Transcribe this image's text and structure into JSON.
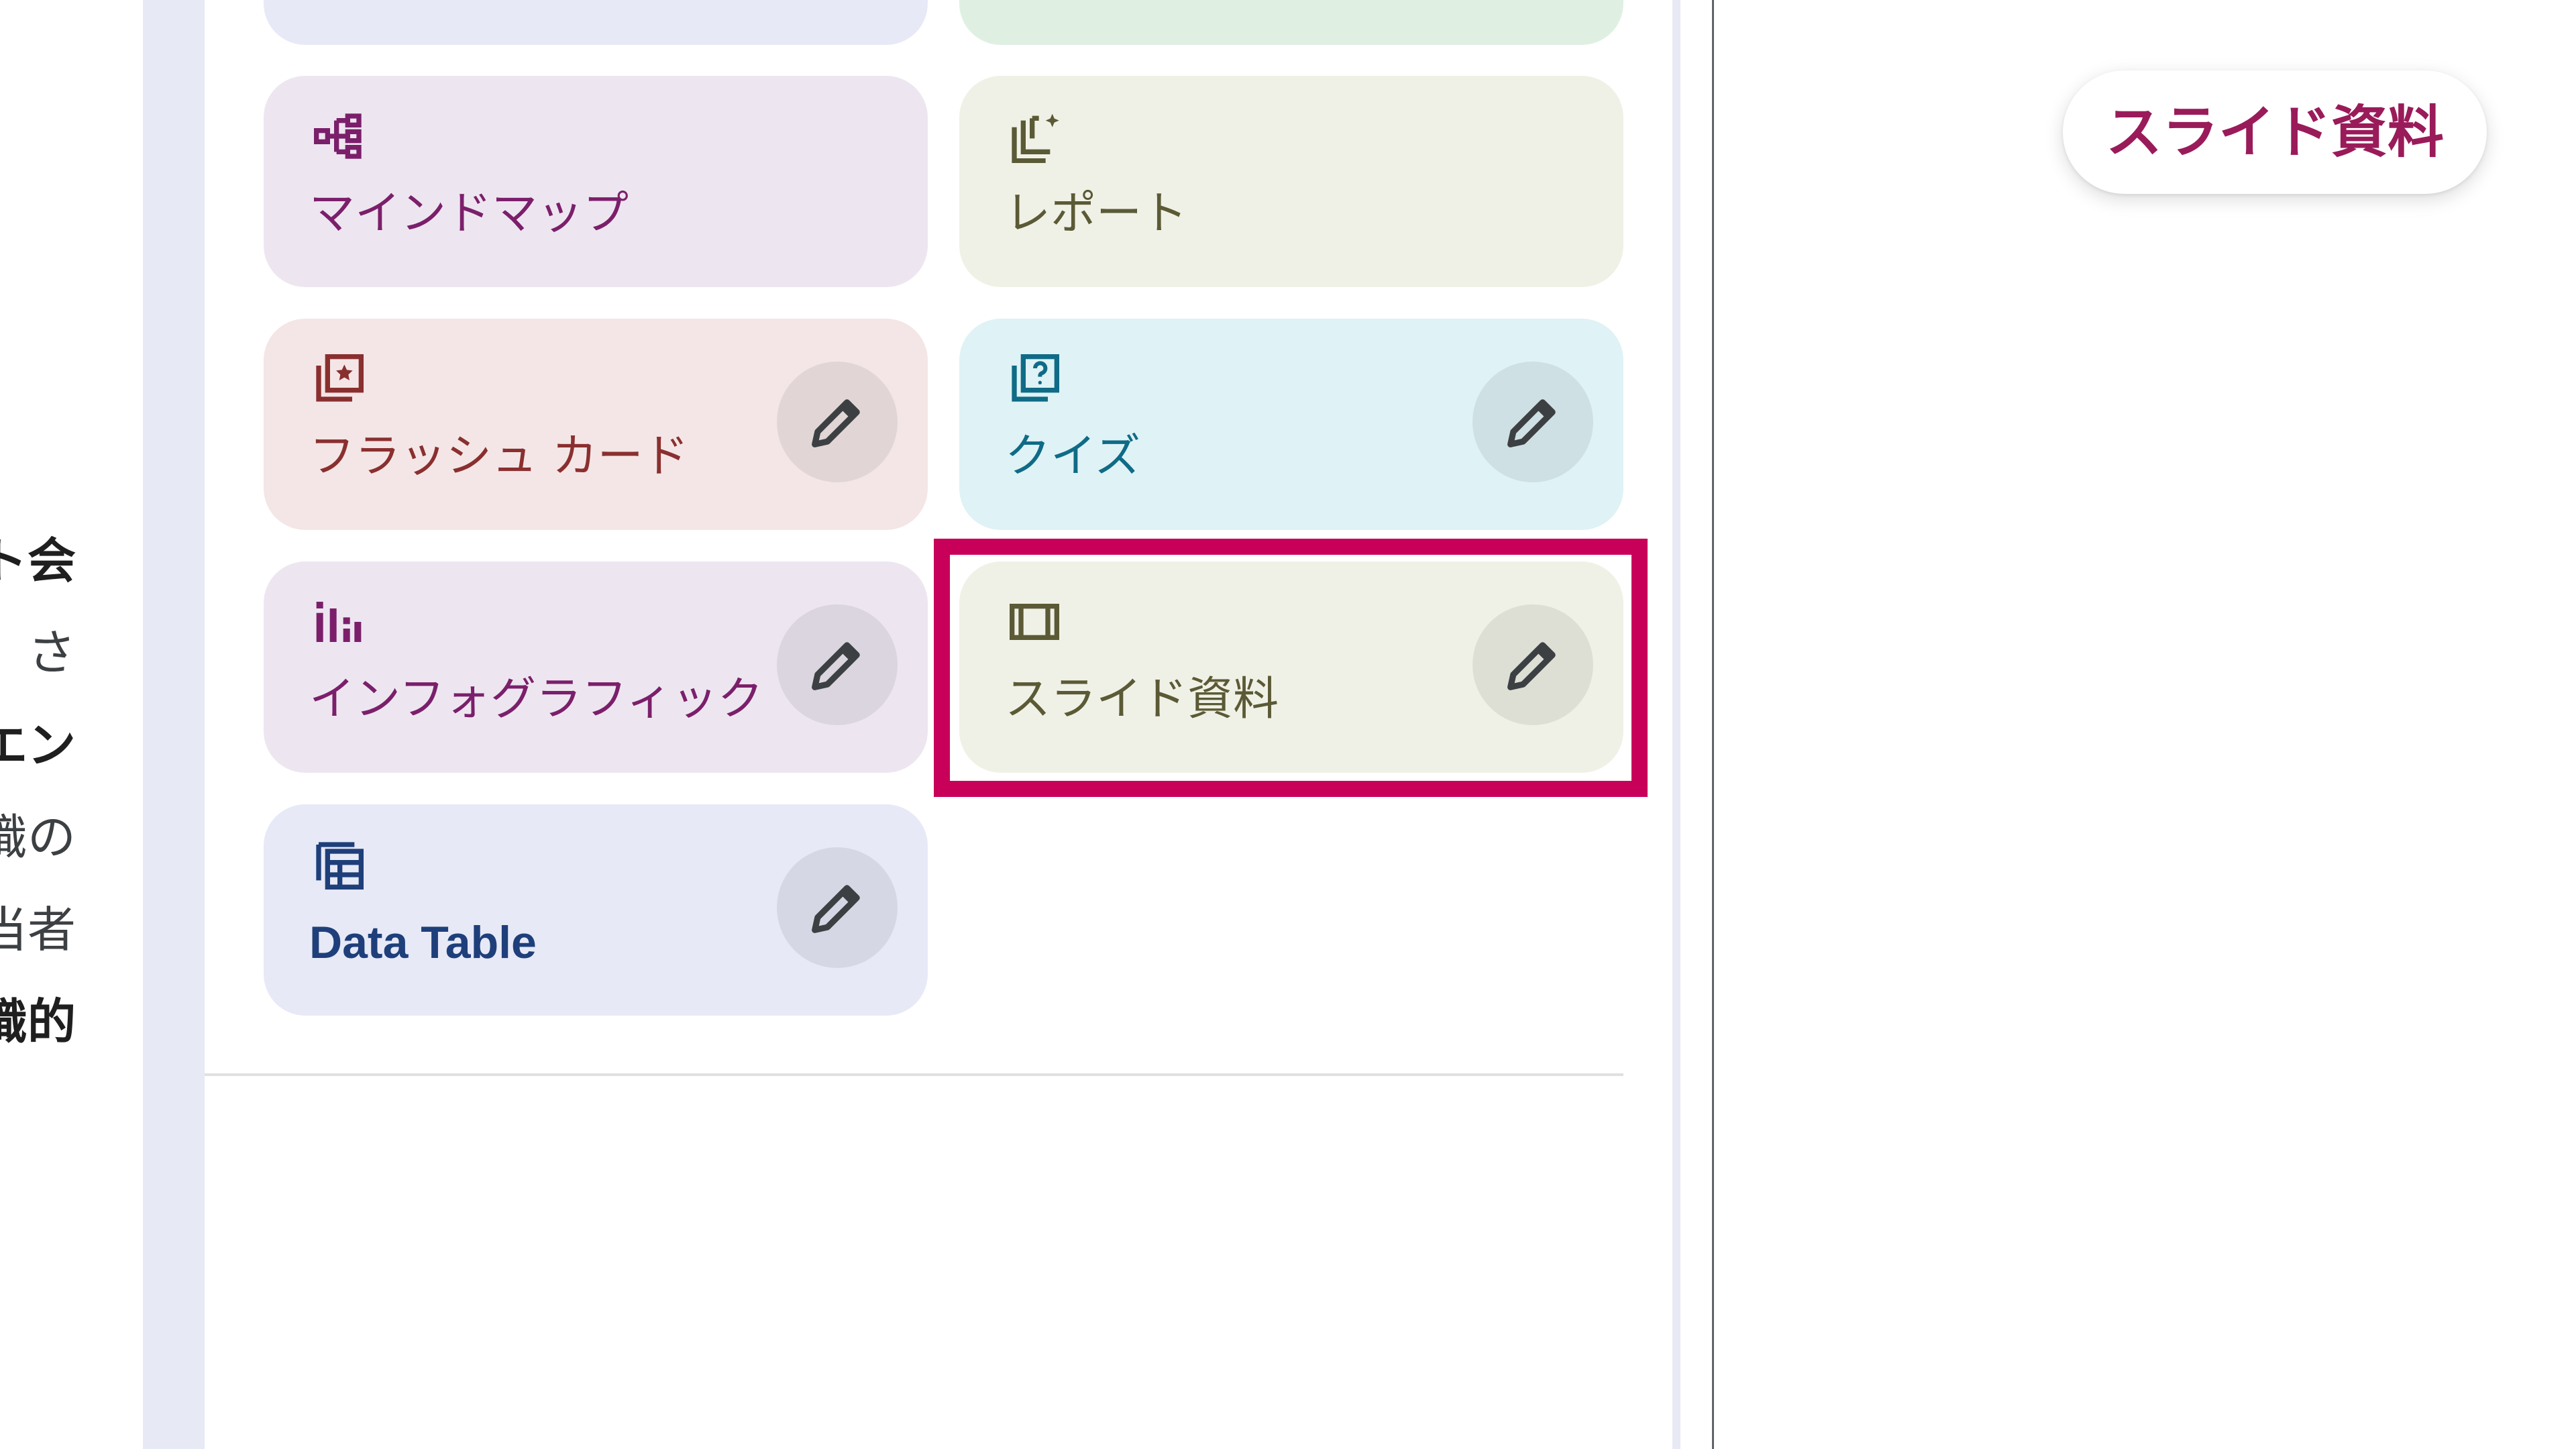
{
  "background_text": {
    "lines": [
      "ト会",
      "さ",
      "エン",
      "識の",
      "当者",
      "識的"
    ]
  },
  "studio": {
    "cards": [
      {
        "id": "mindmap",
        "label": "マインドマップ",
        "icon": "mindmap-icon",
        "editable": false,
        "bg": "#ede6f0",
        "fg": "#7b1f6b"
      },
      {
        "id": "report",
        "label": "レポート",
        "icon": "report-icon",
        "editable": false,
        "bg": "#f0f1e6",
        "fg": "#5b5a36"
      },
      {
        "id": "flashcards",
        "label": "フラッシュ カード",
        "icon": "flashcard-icon",
        "editable": true,
        "bg": "#f4e6e6",
        "fg": "#8a2f2f"
      },
      {
        "id": "quiz",
        "label": "クイズ",
        "icon": "quiz-icon",
        "editable": true,
        "bg": "#dff2f5",
        "fg": "#0f6b86"
      },
      {
        "id": "infographic",
        "label": "インフォグラフィック",
        "icon": "infographic-icon",
        "editable": true,
        "bg": "#ede6f0",
        "fg": "#7b1f6b"
      },
      {
        "id": "slides",
        "label": "スライド資料",
        "icon": "slides-icon",
        "editable": true,
        "bg": "#f0f1e6",
        "fg": "#5b5a36"
      },
      {
        "id": "datatable",
        "label": "Data Table",
        "icon": "table-icon",
        "editable": true,
        "bg": "#e7e9f7",
        "fg": "#1e3f7a"
      }
    ],
    "highlight_color": "#c8005a"
  },
  "callout": {
    "label": "スライド資料"
  }
}
